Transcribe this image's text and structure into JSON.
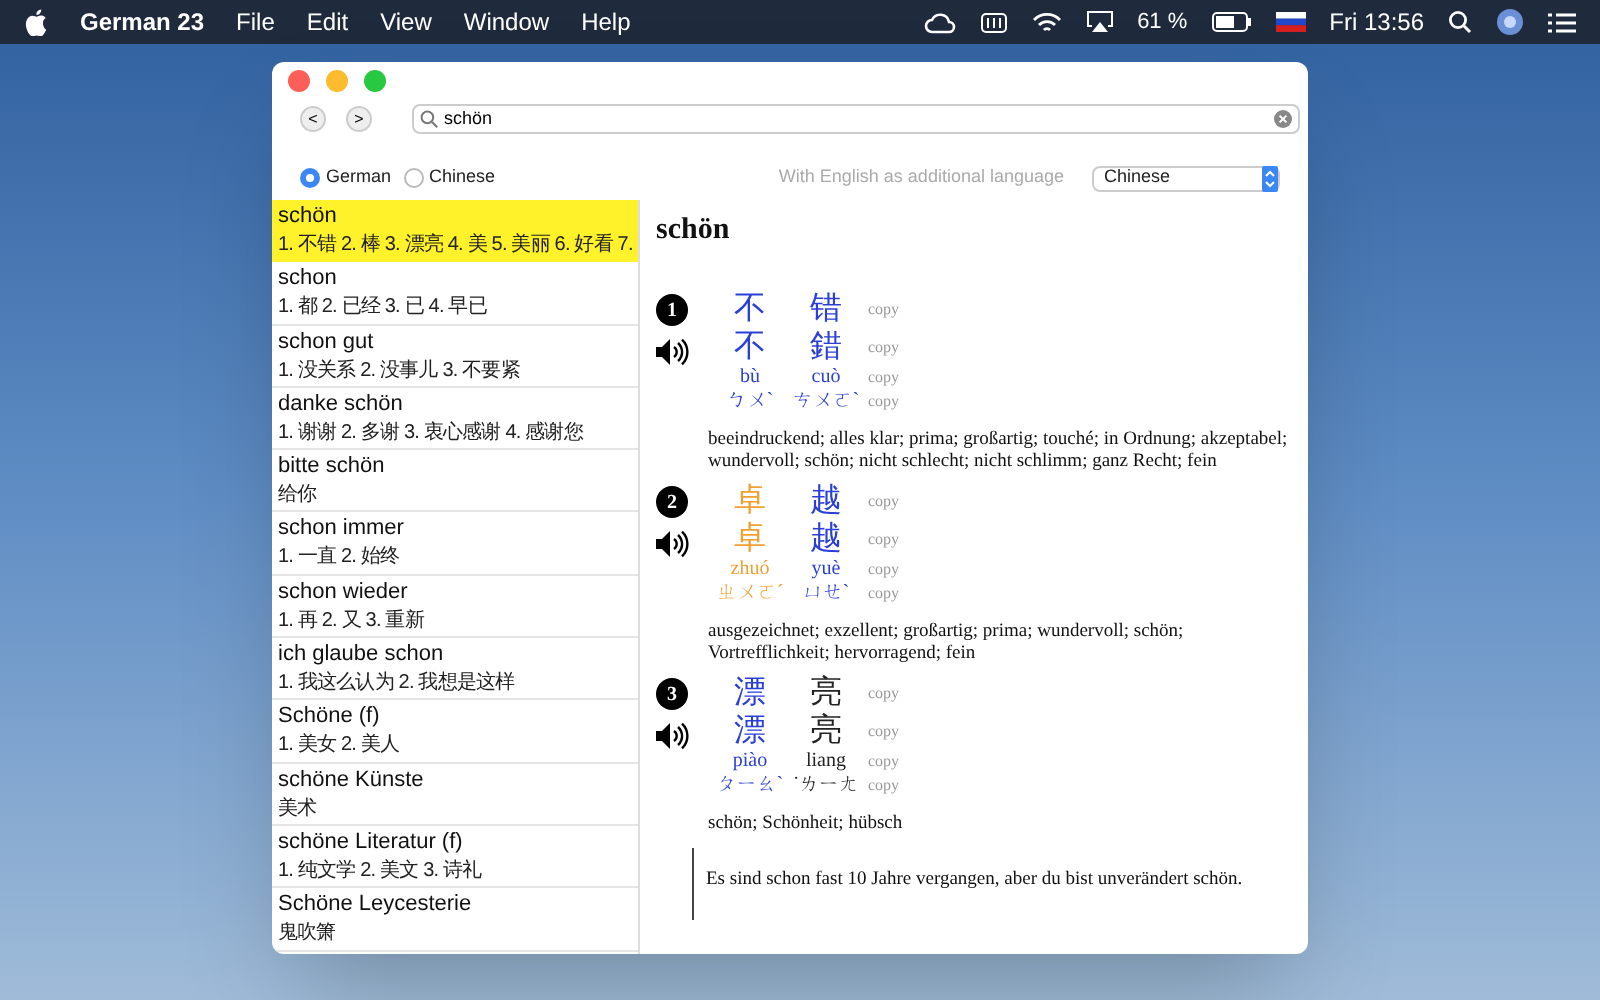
{
  "menubar": {
    "app": "German 23",
    "menus": [
      "File",
      "Edit",
      "View",
      "Window",
      "Help"
    ],
    "battery_percent": "61 %",
    "clock": "Fri 13:56"
  },
  "toolbar": {
    "back": "<",
    "forward": ">",
    "search": {
      "value": "schön"
    }
  },
  "language_options": [
    {
      "label": "German",
      "selected": true
    },
    {
      "label": "Chinese",
      "selected": false
    }
  ],
  "additional_language": {
    "label": "With English as additional language",
    "value": "Chinese"
  },
  "results": [
    {
      "term": "schön",
      "translation": "1. 不错 2. 棒 3. 漂亮 4. 美 5. 美丽 6. 好看 7.",
      "selected": true
    },
    {
      "term": "schon",
      "translation": "1. 都 2. 已经 3. 已 4. 早已",
      "selected": false
    },
    {
      "term": "schon gut",
      "translation": "1. 没关系 2. 没事儿 3. 不要紧",
      "selected": false
    },
    {
      "term": "danke schön",
      "translation": "1. 谢谢 2. 多谢 3. 衷心感谢 4. 感谢您",
      "selected": false
    },
    {
      "term": "bitte schön",
      "translation": "给你",
      "selected": false
    },
    {
      "term": "schon immer",
      "translation": "1. 一直 2. 始终",
      "selected": false
    },
    {
      "term": "schon wieder",
      "translation": "1. 再 2. 又 3. 重新",
      "selected": false
    },
    {
      "term": "ich glaube schon",
      "translation": "1. 我这么认为 2. 我想是这样",
      "selected": false
    },
    {
      "term": "Schöne (f)",
      "translation": "1. 美女 2. 美人",
      "selected": false
    },
    {
      "term": "schöne Künste",
      "translation": "美术",
      "selected": false
    },
    {
      "term": "schöne Literatur (f)",
      "translation": "1. 纯文学 2. 美文 3. 诗礼",
      "selected": false
    },
    {
      "term": "Schöne Leycesterie",
      "translation": "鬼吹箫",
      "selected": false
    }
  ],
  "detail": {
    "headword": "schön",
    "entries": [
      {
        "number": "1",
        "copy_labels": [
          "copy",
          "copy",
          "copy",
          "copy"
        ],
        "syllables": [
          {
            "simplified": "不",
            "traditional": "不",
            "pinyin": "bù",
            "zhuyin": "ㄅㄨˋ",
            "color": "#2a3fd6"
          },
          {
            "simplified": "错",
            "traditional": "錯",
            "pinyin": "cuò",
            "zhuyin": "ㄘㄨㄛˋ",
            "color": "#2a3fd6"
          }
        ],
        "definition": "beeindruckend; alles klar; prima; großartig; touché; in Ordnung; akzeptabel; wundervoll; schön; nicht schlecht; nicht schlimm; ganz Recht; fein"
      },
      {
        "number": "2",
        "copy_labels": [
          "copy",
          "copy",
          "copy",
          "copy"
        ],
        "syllables": [
          {
            "simplified": "卓",
            "traditional": "卓",
            "pinyin": "zhuó",
            "zhuyin": "ㄓㄨㄛˊ",
            "color": "#f0a030"
          },
          {
            "simplified": "越",
            "traditional": "越",
            "pinyin": "yuè",
            "zhuyin": "ㄩㄝˋ",
            "color": "#2a3fd6"
          }
        ],
        "definition": "ausgezeichnet; exzellent; großartig; prima; wundervoll; schön; Vortrefflichkeit; hervorragend; fein"
      },
      {
        "number": "3",
        "copy_labels": [
          "copy",
          "copy",
          "copy",
          "copy"
        ],
        "syllables": [
          {
            "simplified": "漂",
            "traditional": "漂",
            "pinyin": "piào",
            "zhuyin": "ㄆㄧㄠˋ",
            "color": "#2a3fd6"
          },
          {
            "simplified": "亮",
            "traditional": "亮",
            "pinyin": "liang",
            "zhuyin": "˙ㄌㄧㄤ",
            "color": "#222222"
          }
        ],
        "definition": "schön; Schönheit; hübsch"
      }
    ],
    "example": "Es sind schon fast 10 Jahre vergangen, aber du bist unverändert schön."
  }
}
